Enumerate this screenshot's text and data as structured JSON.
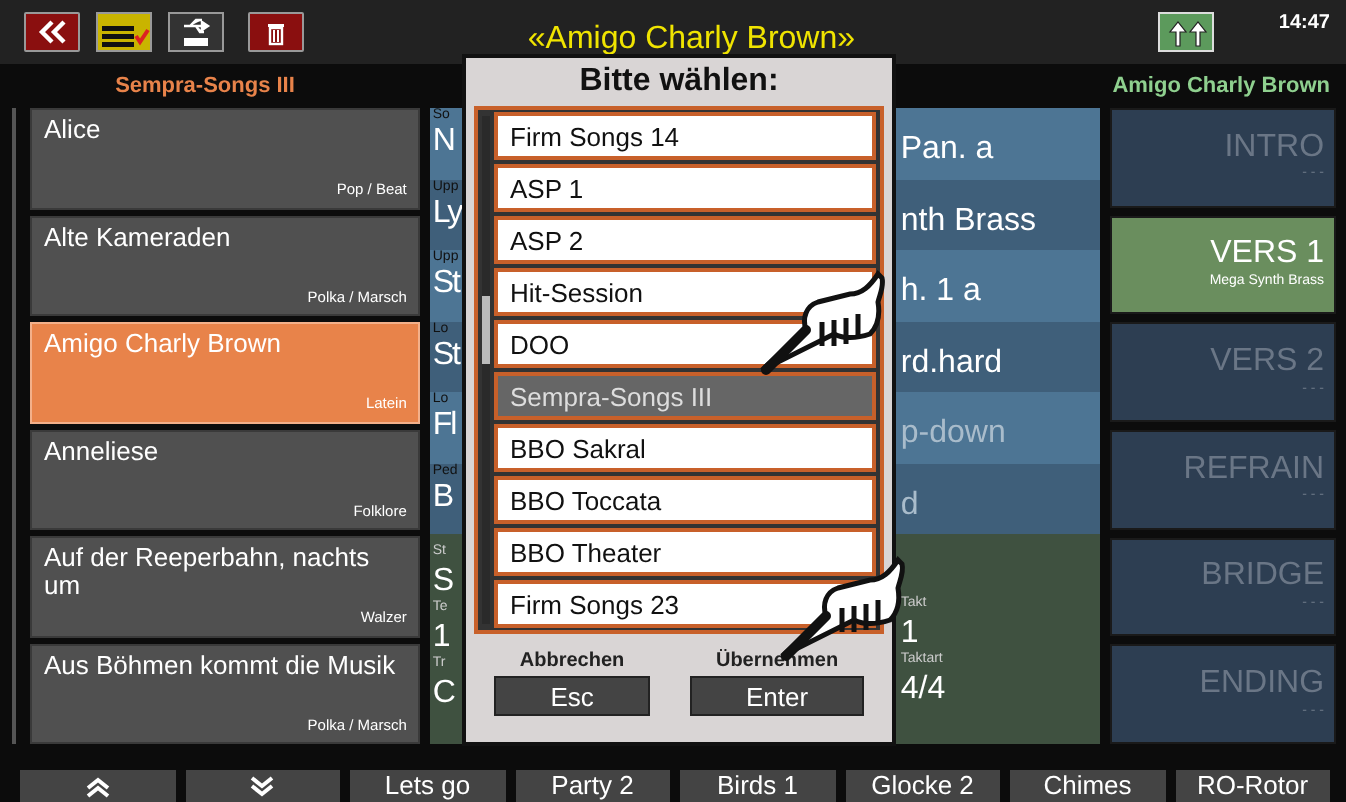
{
  "top_bar": {
    "title": "«Amigo Charly Brown»",
    "time": "14:47"
  },
  "library_name": "Sempra-Songs III",
  "song_name": "Amigo Charly Brown",
  "songs": [
    {
      "title": "Alice",
      "genre": "Pop / Beat",
      "selected": false
    },
    {
      "title": "Alte Kameraden",
      "genre": "Polka / Marsch",
      "selected": false
    },
    {
      "title": "Amigo Charly Brown",
      "genre": "Latein",
      "selected": true
    },
    {
      "title": "Anneliese",
      "genre": "Folklore",
      "selected": false
    },
    {
      "title": "Auf der Reeperbahn, nachts um",
      "genre": "Walzer",
      "selected": false
    },
    {
      "title": "Aus Böhmen kommt die Musik",
      "genre": "Polka / Marsch",
      "selected": false
    }
  ],
  "voices": [
    {
      "label": "So",
      "value": "N",
      "value_right": "Pan.  a",
      "disabled": false
    },
    {
      "label": "Upp",
      "value": "Ly",
      "value_right": "nth Brass",
      "disabled": false
    },
    {
      "label": "Upp",
      "value": "St",
      "value_right": "h. 1  a",
      "disabled": false
    },
    {
      "label": "Lo",
      "value": "St",
      "value_right": "rd.hard",
      "disabled": false
    },
    {
      "label": "Lo",
      "value": "Fl",
      "value_right": "p-down",
      "disabled": true
    },
    {
      "label": "Ped",
      "value": "B",
      "value_right": "d",
      "disabled": true
    }
  ],
  "style_info": {
    "left": [
      {
        "label": "St",
        "value": "S"
      },
      {
        "label": "Te",
        "value": "1"
      },
      {
        "label": "Tr",
        "value": "C"
      }
    ],
    "right": [
      {
        "label": "Takt",
        "value": "1"
      },
      {
        "label": "Taktart",
        "value": "4/4"
      }
    ]
  },
  "sections": [
    {
      "name": "INTRO",
      "voice": "- - -",
      "selected": false
    },
    {
      "name": "VERS 1",
      "voice": "Mega Synth Brass",
      "selected": true
    },
    {
      "name": "VERS 2",
      "voice": "- - -",
      "selected": false
    },
    {
      "name": "REFRAIN",
      "voice": "- - -",
      "selected": false
    },
    {
      "name": "BRIDGE",
      "voice": "- - -",
      "selected": false
    },
    {
      "name": "ENDING",
      "voice": "- - -",
      "selected": false
    }
  ],
  "dialog": {
    "title": "Bitte wählen:",
    "items": [
      {
        "label": "Firm Songs 14",
        "selected": false
      },
      {
        "label": "ASP 1",
        "selected": false
      },
      {
        "label": "ASP 2",
        "selected": false
      },
      {
        "label": "Hit-Session",
        "selected": false
      },
      {
        "label": "DOO",
        "selected": false
      },
      {
        "label": "Sempra-Songs III",
        "selected": true
      },
      {
        "label": "BBO Sakral",
        "selected": false
      },
      {
        "label": "BBO Toccata",
        "selected": false
      },
      {
        "label": "BBO Theater",
        "selected": false
      },
      {
        "label": "Firm Songs 23",
        "selected": false
      }
    ],
    "cancel": {
      "caption": "Abbrechen",
      "key": "Esc"
    },
    "confirm": {
      "caption": "Übernehmen",
      "key": "Enter"
    }
  },
  "bottom_buttons": [
    {
      "kind": "page-up"
    },
    {
      "kind": "page-down"
    },
    {
      "kind": "text",
      "label": "Lets go"
    },
    {
      "kind": "text",
      "label": "Party 2"
    },
    {
      "kind": "text",
      "label": "Birds 1"
    },
    {
      "kind": "text",
      "label": "Glocke 2"
    },
    {
      "kind": "text",
      "label": "Chimes"
    },
    {
      "kind": "text",
      "label": "RO-Rotor"
    }
  ]
}
